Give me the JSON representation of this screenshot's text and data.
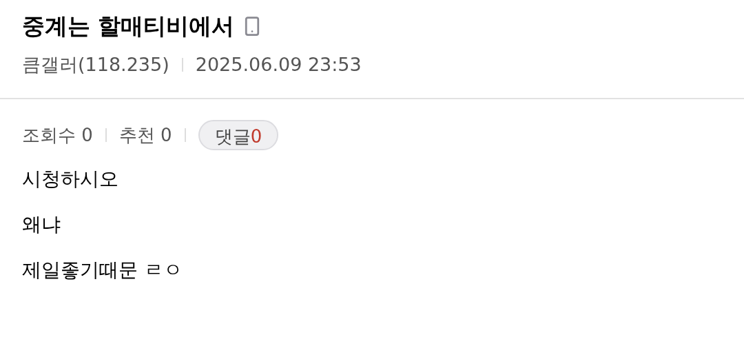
{
  "post": {
    "title": "중계는 할매티비에서",
    "author": "큼갤러(118.235)",
    "date": "2025.06.09 23:53"
  },
  "stats": [
    {
      "kind": "text",
      "label": "조회수",
      "value": "0"
    },
    {
      "kind": "text",
      "label": "추천",
      "value": "0"
    },
    {
      "kind": "badge",
      "label": "댓글",
      "value": "0"
    }
  ],
  "body": [
    "시청하시오",
    "왜냐",
    "제일좋기때문 ㄹㅇ"
  ]
}
